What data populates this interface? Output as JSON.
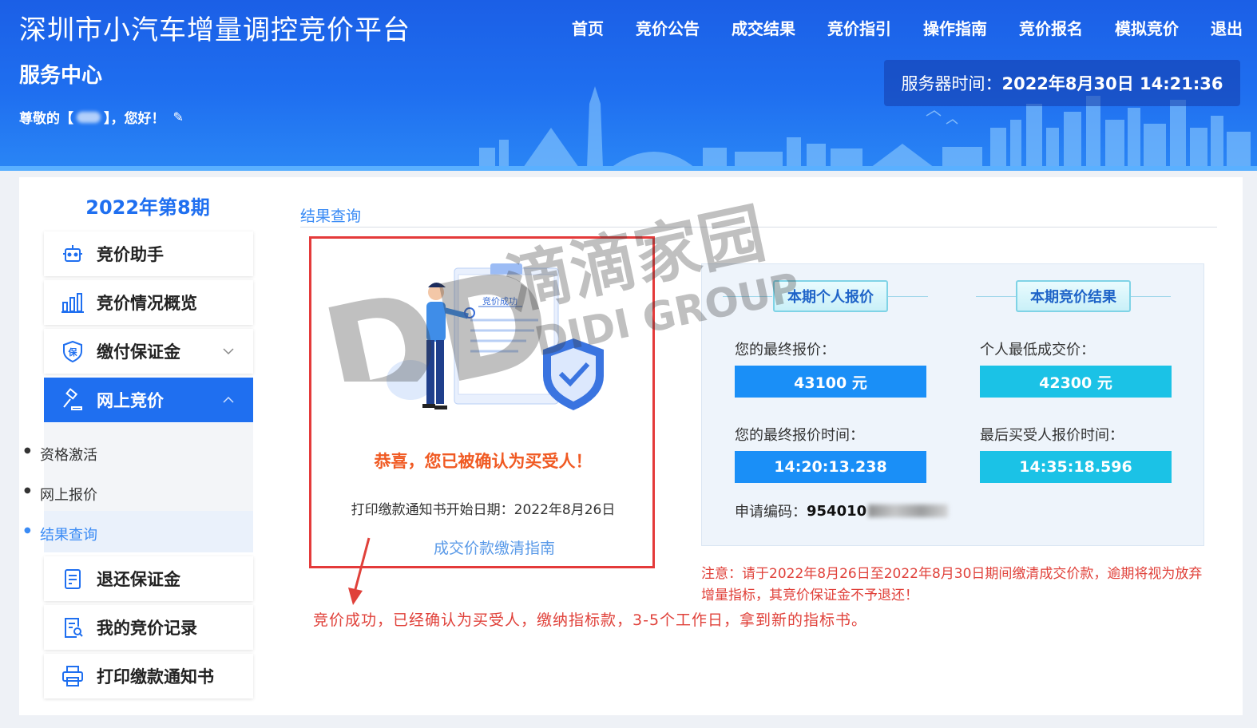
{
  "header": {
    "site_title": "深圳市小汽车增量调控竞价平台",
    "service_center": "服务中心",
    "greeting_prefix": "尊敬的【",
    "greeting_suffix": "】，您好！",
    "server_time_label": "服务器时间：",
    "server_time_value": "2022年8月30日 14:21:36"
  },
  "nav": {
    "items": [
      "首页",
      "竞价公告",
      "成交结果",
      "竞价指引",
      "操作指南",
      "竞价报名",
      "模拟竞价",
      "退出"
    ]
  },
  "sidebar": {
    "period": "2022年第8期",
    "items": [
      {
        "label": "竞价助手",
        "icon": "robot-icon"
      },
      {
        "label": "竞价情况概览",
        "icon": "bar-chart-icon"
      },
      {
        "label": "缴付保证金",
        "icon": "shield-bao-icon"
      },
      {
        "label": "网上竞价",
        "icon": "gavel-icon"
      },
      {
        "label": "退还保证金",
        "icon": "document-return-icon"
      },
      {
        "label": "我的竞价记录",
        "icon": "record-search-icon"
      },
      {
        "label": "打印缴款通知书",
        "icon": "printer-icon"
      }
    ],
    "subitems": [
      "资格激活",
      "网上报价",
      "结果查询"
    ]
  },
  "content": {
    "section_title": "结果查询",
    "illustration_text": "竞价成功",
    "congrats": "恭喜，您已被确认为买受人！",
    "print_date": "打印缴款通知书开始日期：2022年8月26日",
    "guide_link": "成交价款缴清指南"
  },
  "result": {
    "personal_tag": "本期个人报价",
    "result_tag": "本期竞价结果",
    "final_bid_label": "您的最终报价：",
    "final_bid_value": "43100 元",
    "min_price_label": "个人最低成交价：",
    "min_price_value": "42300 元",
    "final_time_label": "您的最终报价时间：",
    "final_time_value": "14:20:13.238",
    "last_time_label": "最后买受人报价时间：",
    "last_time_value": "14:35:18.596",
    "app_code_label": "申请编码：",
    "app_code_value": "954010"
  },
  "notice": "注意：请于2022年8月26日至2022年8月30日期间缴清成交价款，逾期将视为放弃增量指标，其竞价保证金不予退还！",
  "annotation": "竞价成功，已经确认为买受人，缴纳指标款，3-5个工作日，拿到新的指标书。",
  "watermark": {
    "big": "DD",
    "cn": "滴滴家园",
    "en": "DIDI GROUP"
  },
  "colors": {
    "header_blue": "#1f6ff0",
    "accent_blue": "#1a8ff7",
    "accent_cyan": "#1bc2e6",
    "success_orange": "#f05a23",
    "alert_red": "#e0413a"
  }
}
